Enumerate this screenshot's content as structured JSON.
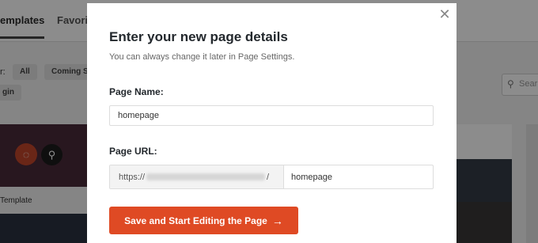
{
  "background": {
    "tabs": [
      "emplates",
      "Favorit"
    ],
    "filter_label": "r:",
    "chips": [
      "All",
      "Coming So",
      "gin"
    ],
    "search_placeholder": "Sear",
    "card_label": "Template"
  },
  "modal": {
    "title": "Enter your new page details",
    "subtitle": "You can always change it later in Page Settings.",
    "name_label": "Page Name:",
    "name_value": "homepage",
    "url_label": "Page URL:",
    "url_prefix_start": "https://",
    "url_prefix_end": "/",
    "url_slug": "homepage",
    "save_label": "Save and Start Editing the Page",
    "save_arrow": "→",
    "close_glyph": "✕"
  },
  "colors": {
    "accent": "#df4a24",
    "overlay": "rgba(0,0,0,0.45)"
  }
}
